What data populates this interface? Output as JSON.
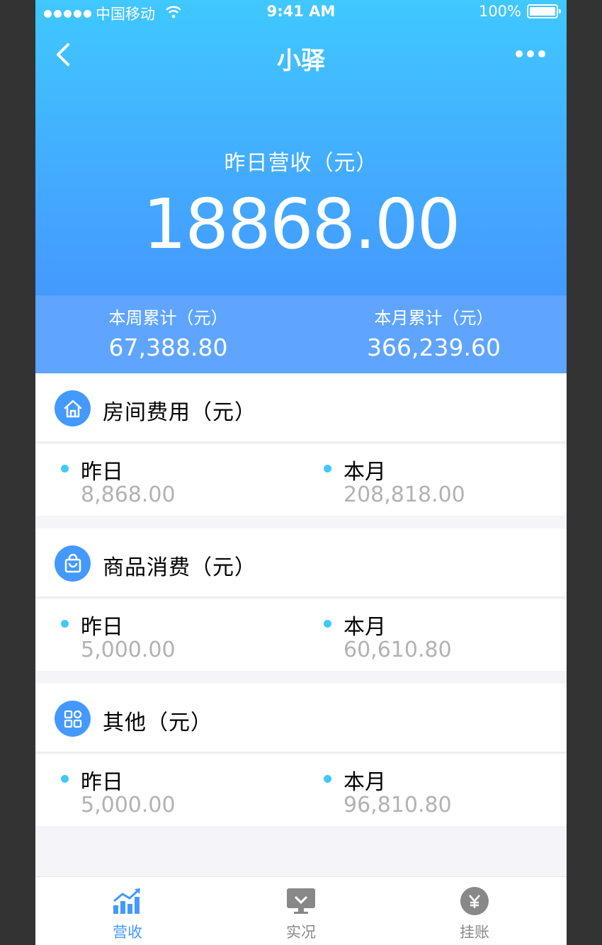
{
  "status_bar": {
    "carrier": "中国移动",
    "time": "9:41 AM",
    "battery": "100%"
  },
  "nav": {
    "title": "小驿"
  },
  "hero": {
    "label": "昨日营收（元）",
    "amount": "18868.00"
  },
  "summary": {
    "week_label": "本周累计（元）",
    "week_value": "67,388.80",
    "month_label": "本月累计（元）",
    "month_value": "366,239.60"
  },
  "sections": [
    {
      "title": "房间费用（元）",
      "icon": "home-icon",
      "yesterday_label": "昨日",
      "yesterday_value": "8,868.00",
      "month_label": "本月",
      "month_value": "208,818.00"
    },
    {
      "title": "商品消费（元）",
      "icon": "shopping-bag-icon",
      "yesterday_label": "昨日",
      "yesterday_value": "5,000.00",
      "month_label": "本月",
      "month_value": "60,610.80"
    },
    {
      "title": "其他（元）",
      "icon": "apps-grid-icon",
      "yesterday_label": "昨日",
      "yesterday_value": "5,000.00",
      "month_label": "本月",
      "month_value": "96,810.80"
    }
  ],
  "tabbar": [
    {
      "label": "营收",
      "icon": "revenue-chart-icon",
      "active": true
    },
    {
      "label": "实况",
      "icon": "monitor-icon",
      "active": false
    },
    {
      "label": "挂账",
      "icon": "coin-icon",
      "active": false
    }
  ],
  "colors": {
    "active": "#4499ff",
    "inactive": "#888888",
    "background": "#f5f5f9",
    "divider": "#ededed",
    "value_gray": "#b2b2b2"
  }
}
